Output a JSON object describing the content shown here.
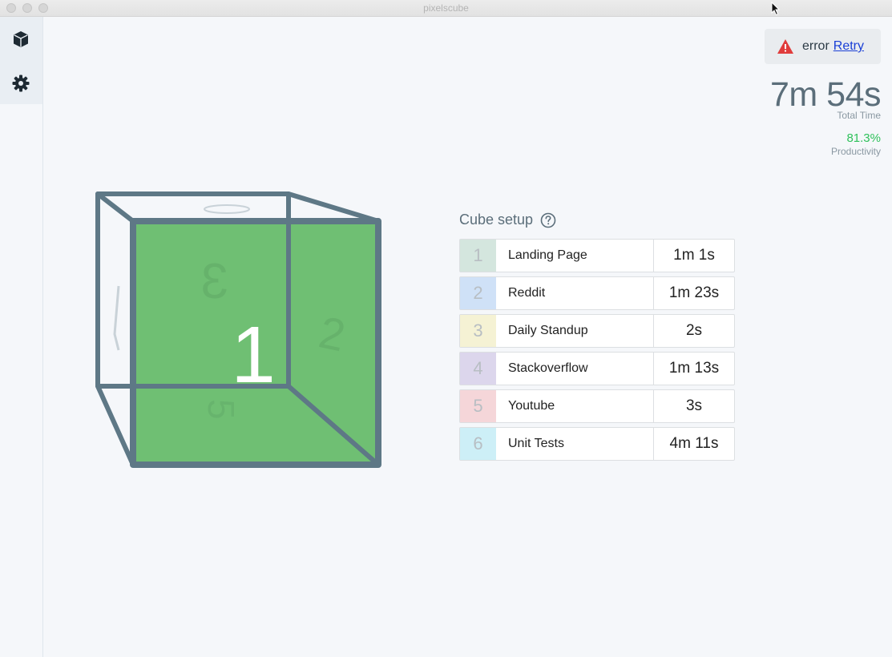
{
  "window": {
    "title": "pixelscube"
  },
  "sidebar": {
    "items": [
      {
        "icon": "cube-icon"
      },
      {
        "icon": "gear-icon"
      }
    ]
  },
  "status": {
    "text": "error",
    "retry_label": "Retry",
    "icon": "warning-icon",
    "icon_color": "#e03c3c"
  },
  "stats": {
    "total_time": "7m 54s",
    "total_time_label": "Total Time",
    "productivity": "81.3%",
    "productivity_label": "Productivity",
    "productivity_color": "#2fc15b"
  },
  "cube": {
    "current_face": "1",
    "front_color": "#6fbf73",
    "edge_color": "#5e7886"
  },
  "setup": {
    "title": "Cube setup",
    "rows": [
      {
        "face": "1",
        "label": "Landing Page",
        "time": "1m 1s",
        "color": "#d4e6de"
      },
      {
        "face": "2",
        "label": "Reddit",
        "time": "1m 23s",
        "color": "#cfe1f7"
      },
      {
        "face": "3",
        "label": "Daily Standup",
        "time": "2s",
        "color": "#f5f2d4"
      },
      {
        "face": "4",
        "label": "Stackoverflow",
        "time": "1m 13s",
        "color": "#dcd6ec"
      },
      {
        "face": "5",
        "label": "Youtube",
        "time": "3s",
        "color": "#f5d6d9"
      },
      {
        "face": "6",
        "label": "Unit Tests",
        "time": "4m 11s",
        "color": "#cdeff7"
      }
    ]
  }
}
